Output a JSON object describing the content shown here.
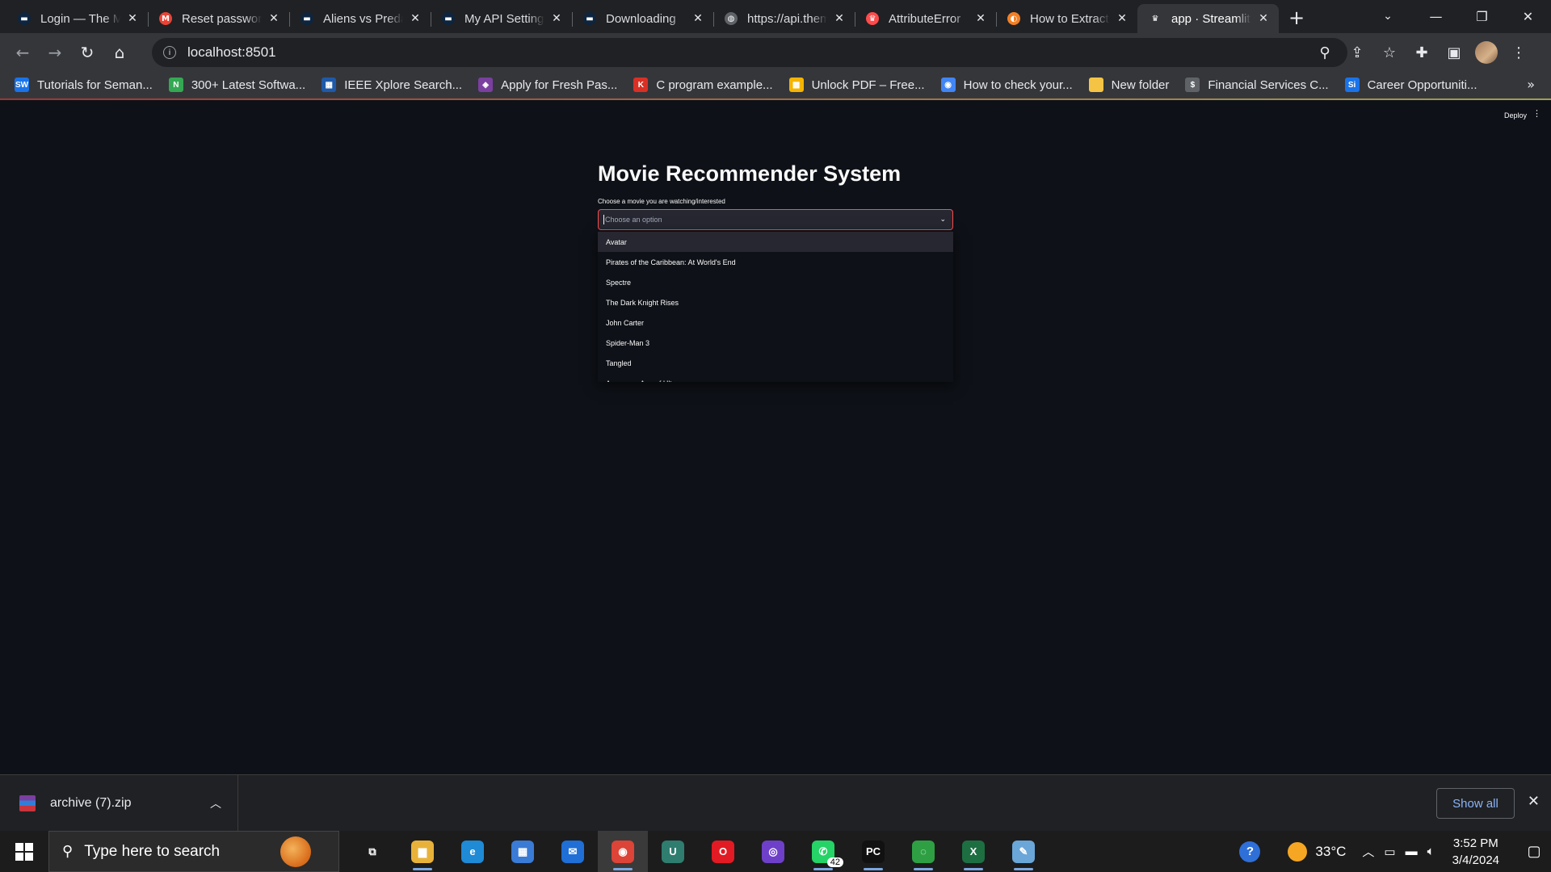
{
  "browser": {
    "tabs": [
      {
        "title": "Login — The Movie Database (TMDB)",
        "favicon_color": "#0d253f",
        "favicon_glyph": "▬"
      },
      {
        "title": "Reset password",
        "favicon_color": "#ea4335",
        "favicon_glyph": "M"
      },
      {
        "title": "Aliens vs Predator",
        "favicon_color": "#0d253f",
        "favicon_glyph": "▬"
      },
      {
        "title": "My API Settings",
        "favicon_color": "#0d253f",
        "favicon_glyph": "▬"
      },
      {
        "title": "Downloading",
        "favicon_color": "#0d253f",
        "favicon_glyph": "▬"
      },
      {
        "title": "https://api.themoviedb.org",
        "favicon_color": "#5f6368",
        "favicon_glyph": "◍"
      },
      {
        "title": "AttributeError",
        "favicon_color": "#ff4b4b",
        "favicon_glyph": "♛"
      },
      {
        "title": "How to Extract",
        "favicon_color": "#f48024",
        "favicon_glyph": "◐"
      },
      {
        "title": "app · Streamlit",
        "favicon_color": "#35363a",
        "favicon_glyph": "♛"
      }
    ],
    "active_tab_index": 8,
    "address": "localhost:8501",
    "bookmarks": [
      {
        "label": "Tutorials for Seman...",
        "icon_color": "#1a73e8",
        "glyph": "SW"
      },
      {
        "label": "300+ Latest Softwa...",
        "icon_color": "#34a853",
        "glyph": "N"
      },
      {
        "label": "IEEE Xplore Search...",
        "icon_color": "#1e5aa8",
        "glyph": "▦"
      },
      {
        "label": "Apply for Fresh Pas...",
        "icon_color": "#7b3fa0",
        "glyph": "◈"
      },
      {
        "label": "C program example...",
        "icon_color": "#d93025",
        "glyph": "K"
      },
      {
        "label": "Unlock PDF – Free...",
        "icon_color": "#f4b400",
        "glyph": "▩"
      },
      {
        "label": "How to check your...",
        "icon_color": "#4285f4",
        "glyph": "◉"
      },
      {
        "label": "New folder",
        "icon_color": "#f6c445",
        "glyph": ""
      },
      {
        "label": "Financial Services C...",
        "icon_color": "#5f6368",
        "glyph": "$"
      },
      {
        "label": "Career Opportuniti...",
        "icon_color": "#1a73e8",
        "glyph": "Si"
      }
    ]
  },
  "app": {
    "deploy_label": "Deploy",
    "menu_glyph": "⋮",
    "title": "Movie Recommender System",
    "select_label": "Choose a movie you are watching/interested",
    "select_placeholder": "Choose an option",
    "options": [
      "Avatar",
      "Pirates of the Caribbean: At World's End",
      "Spectre",
      "The Dark Knight Rises",
      "John Carter",
      "Spider-Man 3",
      "Tangled",
      "Avengers: Age of Ultron"
    ],
    "highlighted_option_index": 0
  },
  "downloads": {
    "file_name": "archive (7).zip",
    "show_all_label": "Show all"
  },
  "taskbar": {
    "search_placeholder": "Type here to search",
    "whatsapp_badge": "42",
    "temperature": "33°C",
    "time": "3:52 PM",
    "date": "3/4/2024",
    "apps": [
      {
        "name": "task-view-icon",
        "glyph": "⧉",
        "color": "transparent",
        "running": false
      },
      {
        "name": "file-explorer-icon",
        "glyph": "▆",
        "color": "#e8b23a",
        "running": true
      },
      {
        "name": "edge-icon",
        "glyph": "e",
        "color": "#1f8ad6",
        "running": false
      },
      {
        "name": "store-icon",
        "glyph": "▦",
        "color": "#3a7bd5",
        "running": false
      },
      {
        "name": "mail-icon",
        "glyph": "✉",
        "color": "#1f6fd6",
        "running": false
      },
      {
        "name": "chrome-icon",
        "glyph": "◉",
        "color": "#db4437",
        "running": true,
        "active": true
      },
      {
        "name": "upwork-icon",
        "glyph": "U",
        "color": "#2f7d6f",
        "running": false
      },
      {
        "name": "opera-icon",
        "glyph": "O",
        "color": "#e21a23",
        "running": false
      },
      {
        "name": "github-icon",
        "glyph": "◎",
        "color": "#6e40c9",
        "running": false
      },
      {
        "name": "whatsapp-icon",
        "glyph": "✆",
        "color": "#25d366",
        "running": true
      },
      {
        "name": "pycharm-icon",
        "glyph": "PC",
        "color": "#111111",
        "running": true
      },
      {
        "name": "loader-icon",
        "glyph": "◌",
        "color": "#2ea043",
        "running": true
      },
      {
        "name": "excel-icon",
        "glyph": "X",
        "color": "#1d6f42",
        "running": true
      },
      {
        "name": "paint-icon",
        "glyph": "✎",
        "color": "#6aa6d8",
        "running": true
      }
    ]
  }
}
